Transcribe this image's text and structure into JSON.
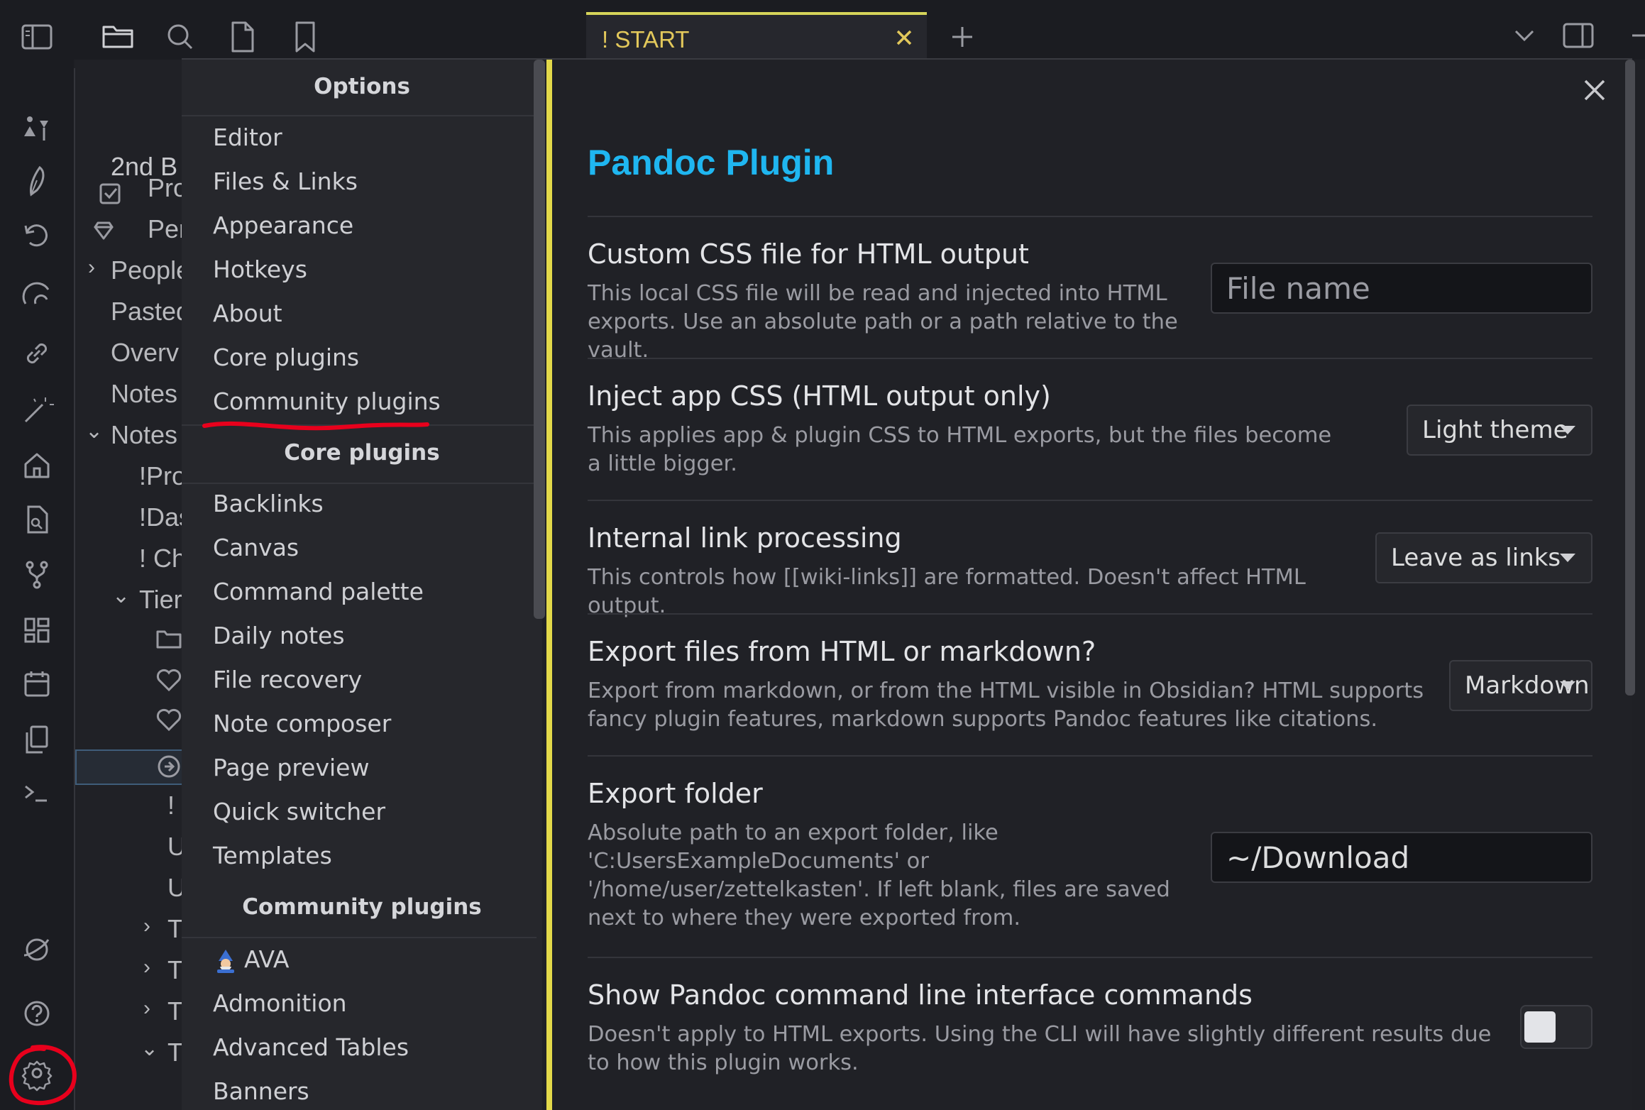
{
  "tab": {
    "title": "! START"
  },
  "explorer": {
    "rows": [
      "2nd B",
      "Pro",
      "Per",
      "People",
      "Pasted",
      "Overv",
      "Notes",
      "Notes",
      "!Pro",
      "!Das",
      "! Ch",
      "Tier",
      "!",
      "U",
      "U",
      "T",
      "T",
      "T",
      "T"
    ]
  },
  "options": {
    "heading": "Options",
    "items": [
      "Editor",
      "Files & Links",
      "Appearance",
      "Hotkeys",
      "About",
      "Core plugins",
      "Community plugins"
    ]
  },
  "core_plugins": {
    "heading": "Core plugins",
    "items": [
      "Backlinks",
      "Canvas",
      "Command palette",
      "Daily notes",
      "File recovery",
      "Note composer",
      "Page preview",
      "Quick switcher",
      "Templates"
    ]
  },
  "community_plugins": {
    "heading": "Community plugins",
    "items": [
      "AVA",
      "Admonition",
      "Advanced Tables",
      "Banners"
    ]
  },
  "plugin": {
    "title": "Pandoc Plugin",
    "settings": [
      {
        "name": "Custom CSS file for HTML output",
        "desc": "This local CSS file will be read and injected into HTML exports. Use an absolute path or a path relative to the vault.",
        "placeholder": "File name"
      },
      {
        "name": "Inject app CSS (HTML output only)",
        "desc": "This applies app & plugin CSS to HTML exports, but the files become a little bigger.",
        "value": "Light theme"
      },
      {
        "name": "Internal link processing",
        "desc": "This controls how [[wiki-links]] are formatted. Doesn't affect HTML output.",
        "value": "Leave as links"
      },
      {
        "name": "Export files from HTML or markdown?",
        "desc": "Export from markdown, or from the HTML visible in Obsidian? HTML supports fancy plugin features, markdown supports Pandoc features like citations.",
        "value": "Markdown"
      },
      {
        "name": "Export folder",
        "desc": "Absolute path to an export folder, like 'C:UsersExampleDocuments' or '/home/user/zettelkasten'. If left blank, files are saved next to where they were exported from.",
        "value": "~/Download"
      },
      {
        "name": "Show Pandoc command line interface commands",
        "desc": "Doesn't apply to HTML exports. Using the CLI will have slightly different results due to how this plugin works.",
        "enabled": false
      }
    ]
  },
  "colors": {
    "accent": "#1fb6f0",
    "highlight": "#e3d94a",
    "annotation": "#e8001c"
  }
}
